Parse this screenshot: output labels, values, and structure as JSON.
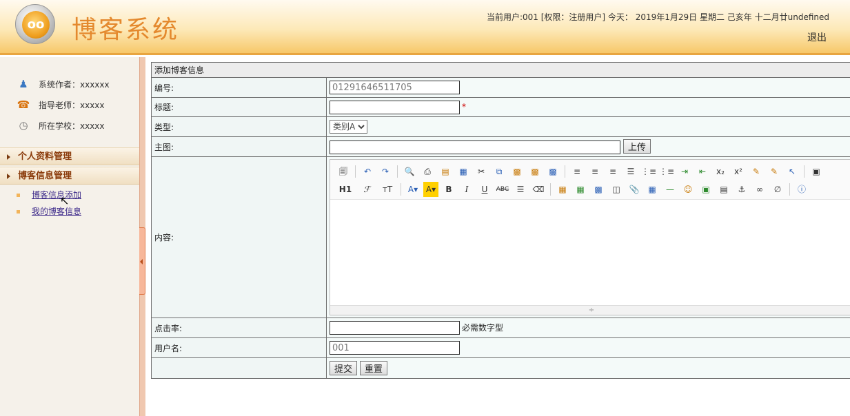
{
  "header": {
    "logo_text": "oo",
    "app_title": "博客系统",
    "user_info": "当前用户:001 [权限：注册用户] 今天： 2019年1月29日 星期二 己亥年 十二月廿undefined",
    "logout": "退出"
  },
  "sidebar": {
    "info": [
      {
        "icon": "author-icon",
        "text": "系统作者：xxxxxx"
      },
      {
        "icon": "teacher-icon",
        "text": "指导老师：xxxxx"
      },
      {
        "icon": "school-icon",
        "text": "所在学校：xxxxx"
      }
    ],
    "menus": [
      {
        "label": "个人资料管理"
      },
      {
        "label": "博客信息管理",
        "items": [
          "博客信息添加",
          "我的博客信息"
        ]
      }
    ]
  },
  "form": {
    "title": "添加博客信息",
    "fields": {
      "number": {
        "label": "编号:",
        "value": "01291646511705"
      },
      "title": {
        "label": "标题:",
        "value": "",
        "required_mark": "*"
      },
      "type": {
        "label": "类型:",
        "selected": "类别A"
      },
      "image": {
        "label": "主图:",
        "value": "",
        "upload_label": "上传"
      },
      "content": {
        "label": "内容:"
      },
      "clicks": {
        "label": "点击率:",
        "value": "",
        "hint": "必需数字型"
      },
      "username": {
        "label": "用户名:",
        "value": "001"
      }
    },
    "submit_label": "提交",
    "reset_label": "重置"
  },
  "editor": {
    "row1": [
      "source-icon",
      "undo-icon",
      "redo-icon",
      "preview-icon",
      "print-icon",
      "template-icon",
      "code-icon",
      "cut-icon",
      "copy-icon",
      "paste-icon",
      "paste-text-icon",
      "paste-word-icon",
      "align-left-icon",
      "align-center-icon",
      "align-right-icon",
      "justify-icon",
      "ordered-list-icon",
      "unordered-list-icon",
      "indent-icon",
      "outdent-icon",
      "subscript-icon",
      "superscript-icon",
      "clear-format-icon",
      "select-all-icon",
      "select-icon",
      "fullscreen-icon"
    ],
    "row2_text": {
      "heading": "H1",
      "font": "ℱ",
      "size": "тT",
      "bold": "B",
      "italic": "I",
      "underline": "U",
      "strike": "ABC"
    }
  }
}
